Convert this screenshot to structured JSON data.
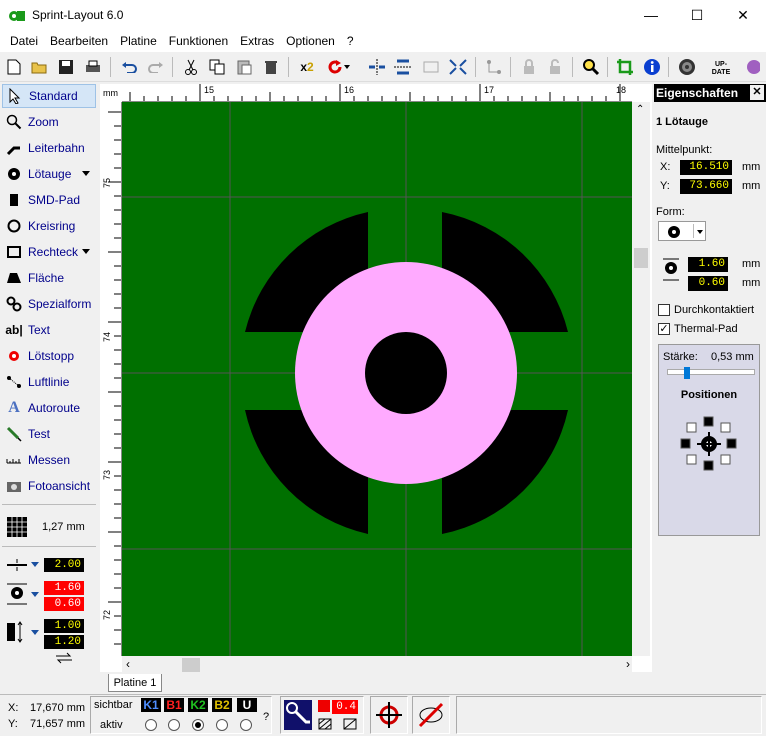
{
  "window": {
    "title": "Sprint-Layout 6.0",
    "minimize": "—",
    "maximize": "☐",
    "close": "✕"
  },
  "menu": [
    "Datei",
    "Bearbeiten",
    "Platine",
    "Funktionen",
    "Extras",
    "Optionen",
    "?"
  ],
  "tools": [
    {
      "label": "Standard",
      "icon": "cursor-icon"
    },
    {
      "label": "Zoom",
      "icon": "zoom-icon"
    },
    {
      "label": "Leiterbahn",
      "icon": "track-icon"
    },
    {
      "label": "Lötauge",
      "icon": "pad-icon"
    },
    {
      "label": "SMD-Pad",
      "icon": "smd-pad-icon"
    },
    {
      "label": "Kreisring",
      "icon": "ring-icon"
    },
    {
      "label": "Rechteck",
      "icon": "rectangle-icon"
    },
    {
      "label": "Fläche",
      "icon": "area-icon"
    },
    {
      "label": "Spezialform",
      "icon": "special-shape-icon"
    },
    {
      "label": "Text",
      "icon": "text-icon"
    },
    {
      "label": "Lötstopp",
      "icon": "solder-mask-icon"
    },
    {
      "label": "Luftlinie",
      "icon": "airwire-icon"
    },
    {
      "label": "Autoroute",
      "icon": "autoroute-icon"
    },
    {
      "label": "Test",
      "icon": "test-icon"
    },
    {
      "label": "Messen",
      "icon": "measure-icon"
    },
    {
      "label": "Fotoansicht",
      "icon": "camera-icon"
    }
  ],
  "grid": {
    "value": "1,27 mm"
  },
  "left_fields": {
    "track_width": "2.00",
    "pad_outer": "1.60",
    "pad_inner": "0.60",
    "smd_w": "1.00",
    "smd_h": "1.20"
  },
  "ruler": {
    "unit": "mm",
    "h_labels": [
      "15",
      "16",
      "17",
      "18"
    ],
    "v_labels": [
      "75",
      "74",
      "73",
      "72"
    ]
  },
  "tab": "Platine 1",
  "properties": {
    "header": "Eigenschaften",
    "selection": "1 Lötauge",
    "center_label": "Mittelpunkt:",
    "x_label": "X:",
    "x_value": "16.510",
    "y_label": "Y:",
    "y_value": "73.660",
    "unit": "mm",
    "form_label": "Form:",
    "outer": "1.60",
    "inner": "0.60",
    "plated": "Durchkontaktiert",
    "plated_checked": false,
    "thermal": "Thermal-Pad",
    "thermal_checked": true,
    "strength_label": "Stärke:",
    "strength_value": "0,53 mm",
    "strength_fraction": 0.2,
    "positions_label": "Positionen"
  },
  "status": {
    "x_label": "X:",
    "x_value": "17,670 mm",
    "y_label": "Y:",
    "y_value": "71,657 mm",
    "visible_label": "sichtbar",
    "active_label": "aktiv",
    "layers": [
      {
        "name": "K1",
        "color": "#4f8fff"
      },
      {
        "name": "B1",
        "color": "#ff2020"
      },
      {
        "name": "K2",
        "color": "#20c020"
      },
      {
        "name": "B2",
        "color": "#e0c000"
      },
      {
        "name": "U",
        "color": "#ffffff"
      }
    ],
    "active_layer": "K2",
    "question": "?",
    "value": "0.4"
  },
  "colors": {
    "board": "#007000",
    "pad": "#ffaaff",
    "copper": "#000000",
    "accent": "#0078d7"
  }
}
